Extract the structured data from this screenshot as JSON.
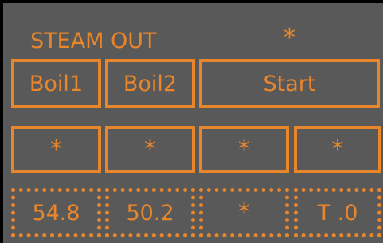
{
  "header": {
    "title": "STEAM OUT",
    "indicator": "*"
  },
  "controls": {
    "boil1_label": "Boil1",
    "boil2_label": "Boil2",
    "start_label": "Start"
  },
  "status_row": [
    "*",
    "*",
    "*",
    "*"
  ],
  "readings": [
    "54.8",
    "50.2",
    "*",
    "T .0"
  ],
  "colors": {
    "background": "#595959",
    "accent": "#e8862b",
    "frame": "#000000"
  }
}
